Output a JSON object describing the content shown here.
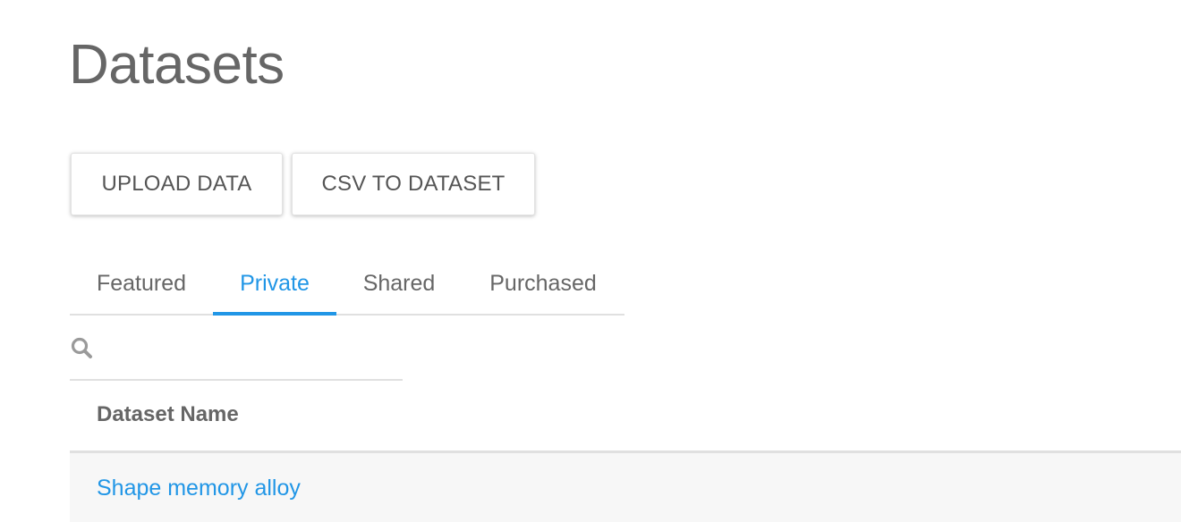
{
  "page": {
    "title": "Datasets"
  },
  "actions": {
    "upload_label": "UPLOAD DATA",
    "csv_label": "CSV TO DATASET"
  },
  "tabs": {
    "items": [
      {
        "label": "Featured",
        "active": false
      },
      {
        "label": "Private",
        "active": true
      },
      {
        "label": "Shared",
        "active": false
      },
      {
        "label": "Purchased",
        "active": false
      }
    ]
  },
  "search": {
    "icon": "search-icon",
    "value": "",
    "placeholder": ""
  },
  "table": {
    "columns": [
      "Dataset Name"
    ],
    "rows": [
      {
        "name": "Shape memory alloy"
      }
    ]
  },
  "colors": {
    "accent": "#2196e6",
    "text": "#666666",
    "divider": "#e0e0e0",
    "row_background": "#f7f7f7"
  }
}
